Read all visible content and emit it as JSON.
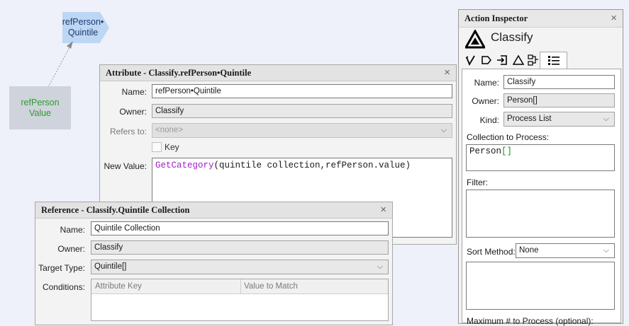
{
  "canvas": {
    "ref_node_label": "refPerson•\nQuintile",
    "value_node_label": "refPerson\nValue"
  },
  "attribute_dialog": {
    "title": "Attribute - Classify.refPerson•Quintile",
    "name_label": "Name:",
    "name_value": "refPerson•Quintile",
    "owner_label": "Owner:",
    "owner_value": "Classify",
    "refers_label": "Refers to:",
    "refers_value": "<none>",
    "key_label": "Key",
    "newvalue_label": "New Value:",
    "expr_func": "GetCategory",
    "expr_args": "(quintile collection,refPerson.value)"
  },
  "reference_dialog": {
    "title": "Reference - Classify.Quintile Collection",
    "name_label": "Name:",
    "name_value": "Quintile Collection",
    "owner_label": "Owner:",
    "owner_value": "Classify",
    "target_label": "Target Type:",
    "target_value": "Quintile[]",
    "conditions_label": "Conditions:",
    "col_key": "Attribute Key",
    "col_match": "Value to Match"
  },
  "inspector": {
    "title": "Action Inspector",
    "action_name": "Classify",
    "name_label": "Name:",
    "name_value": "Classify",
    "owner_label": "Owner:",
    "owner_value": "Person[]",
    "kind_label": "Kind:",
    "kind_value": "Process List",
    "collection_label": "Collection to Process:",
    "collection_type": "Person",
    "collection_brackets": "[]",
    "filter_label": "Filter:",
    "sort_label": "Sort Method:",
    "sort_value": "None",
    "max_label": "Maximum # to Process (optional):"
  },
  "icons": {
    "close": "×",
    "dropdown": "⌵"
  },
  "colors": {
    "keyword_purple": "#a020c8",
    "bracket_green": "#1f8f1f",
    "value_node_text": "#2f9a2f",
    "ref_node_fill": "#bcd6f4"
  }
}
